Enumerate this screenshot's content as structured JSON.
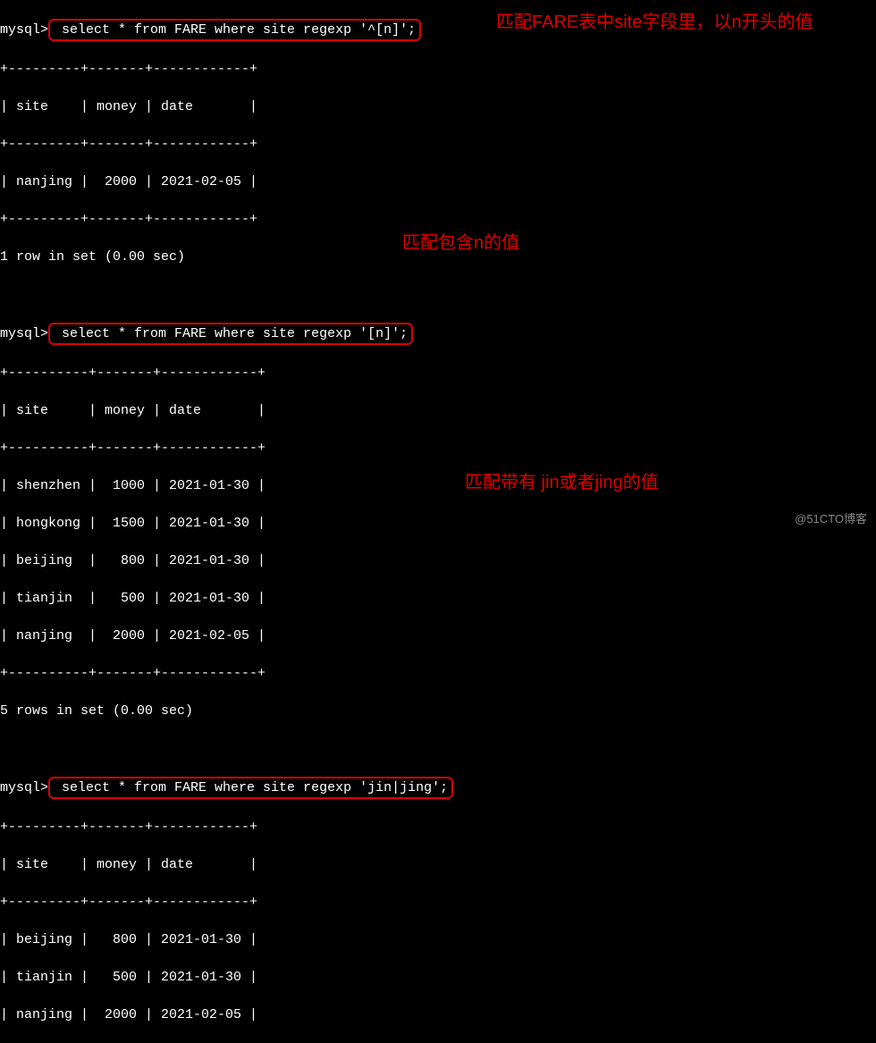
{
  "q1": {
    "prompt": "mysql>",
    "sql": " select * from FARE where site regexp '^[n]';",
    "sep": "+---------+-------+------------+",
    "hdr": "| site    | money | date       |",
    "rows": [
      "| nanjing |  2000 | 2021-02-05 |"
    ],
    "summary": "1 row in set (0.00 sec)"
  },
  "q2": {
    "prompt": "mysql>",
    "sql": " select * from FARE where site regexp '[n]';",
    "sep": "+----------+-------+------------+",
    "hdr": "| site     | money | date       |",
    "rows": [
      "| shenzhen |  1000 | 2021-01-30 |",
      "| hongkong |  1500 | 2021-01-30 |",
      "| beijing  |   800 | 2021-01-30 |",
      "| tianjin  |   500 | 2021-01-30 |",
      "| nanjing  |  2000 | 2021-02-05 |"
    ],
    "summary": "5 rows in set (0.00 sec)"
  },
  "q3": {
    "prompt": "mysql>",
    "sql": " select * from FARE where site regexp 'jin|jing';",
    "sep": "+---------+-------+------------+",
    "hdr": "| site    | money | date       |",
    "rows": [
      "| beijing |   800 | 2021-01-30 |",
      "| tianjin |   500 | 2021-01-30 |",
      "| nanjing |  2000 | 2021-02-05 |"
    ]
  },
  "annot": {
    "a1": "匹配FARE表中site字段里，以n开头的值",
    "a2": "匹配包含n的值",
    "a3": "匹配带有 jin或者jing的值"
  },
  "watermark": "@51CTO博客"
}
